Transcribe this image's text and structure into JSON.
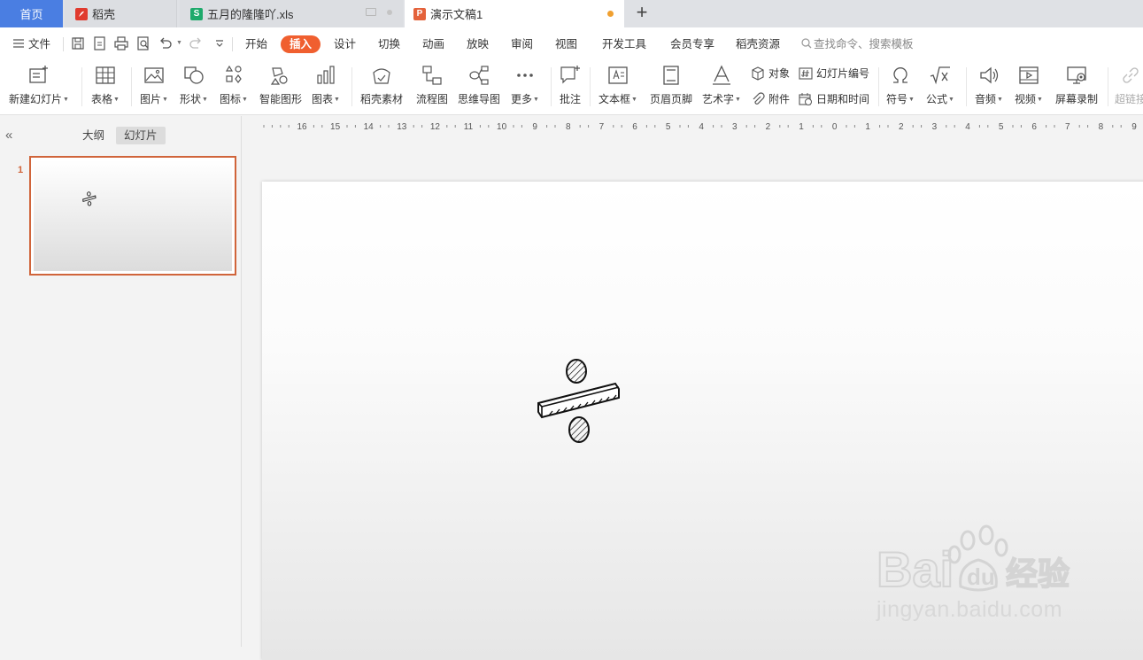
{
  "tabs": {
    "home": "首页",
    "daoke": "稻壳",
    "xls": "五月的隆隆吖.xls",
    "ppt": "演示文稿1",
    "add": "+"
  },
  "menu": {
    "file": "文件",
    "items": [
      "开始",
      "插入",
      "设计",
      "切换",
      "动画",
      "放映",
      "审阅",
      "视图",
      "开发工具",
      "会员专享",
      "稻壳资源"
    ],
    "active": "插入",
    "search_placeholder": "查找命令、搜索模板"
  },
  "ribbon": {
    "new_slide": "新建幻灯片",
    "table": "表格",
    "picture": "图片",
    "shape": "形状",
    "icon": "图标",
    "smart_graphic": "智能图形",
    "chart": "图表",
    "daoke_material": "稻壳素材",
    "flowchart": "流程图",
    "mindmap": "思维导图",
    "more": "更多",
    "comment": "批注",
    "textbox": "文本框",
    "header_footer": "页眉页脚",
    "wordart": "艺术字",
    "object": "对象",
    "attachment": "附件",
    "slide_number": "幻灯片编号",
    "datetime": "日期和时间",
    "symbol": "符号",
    "formula": "公式",
    "audio": "音频",
    "video": "视频",
    "screen_record": "屏幕录制",
    "hyperlink": "超链接"
  },
  "panel": {
    "outline_tab": "大纲",
    "slides_tab": "幻灯片",
    "slide_number": "1"
  },
  "ruler": {
    "labels": [
      "16",
      "15",
      "14",
      "13",
      "12",
      "11",
      "10",
      "9",
      "8",
      "7",
      "6",
      "5",
      "4",
      "3",
      "2",
      "1",
      "0",
      "1",
      "2",
      "3",
      "4",
      "5",
      "6",
      "7",
      "8",
      "9"
    ]
  },
  "watermark": {
    "url": "jingyan.baidu.com",
    "brand": "Bai",
    "brand_suffix": "经验"
  },
  "colors": {
    "accent": "#f05f2f",
    "home_tab": "#4a7ee2",
    "selection": "#d0643a"
  }
}
